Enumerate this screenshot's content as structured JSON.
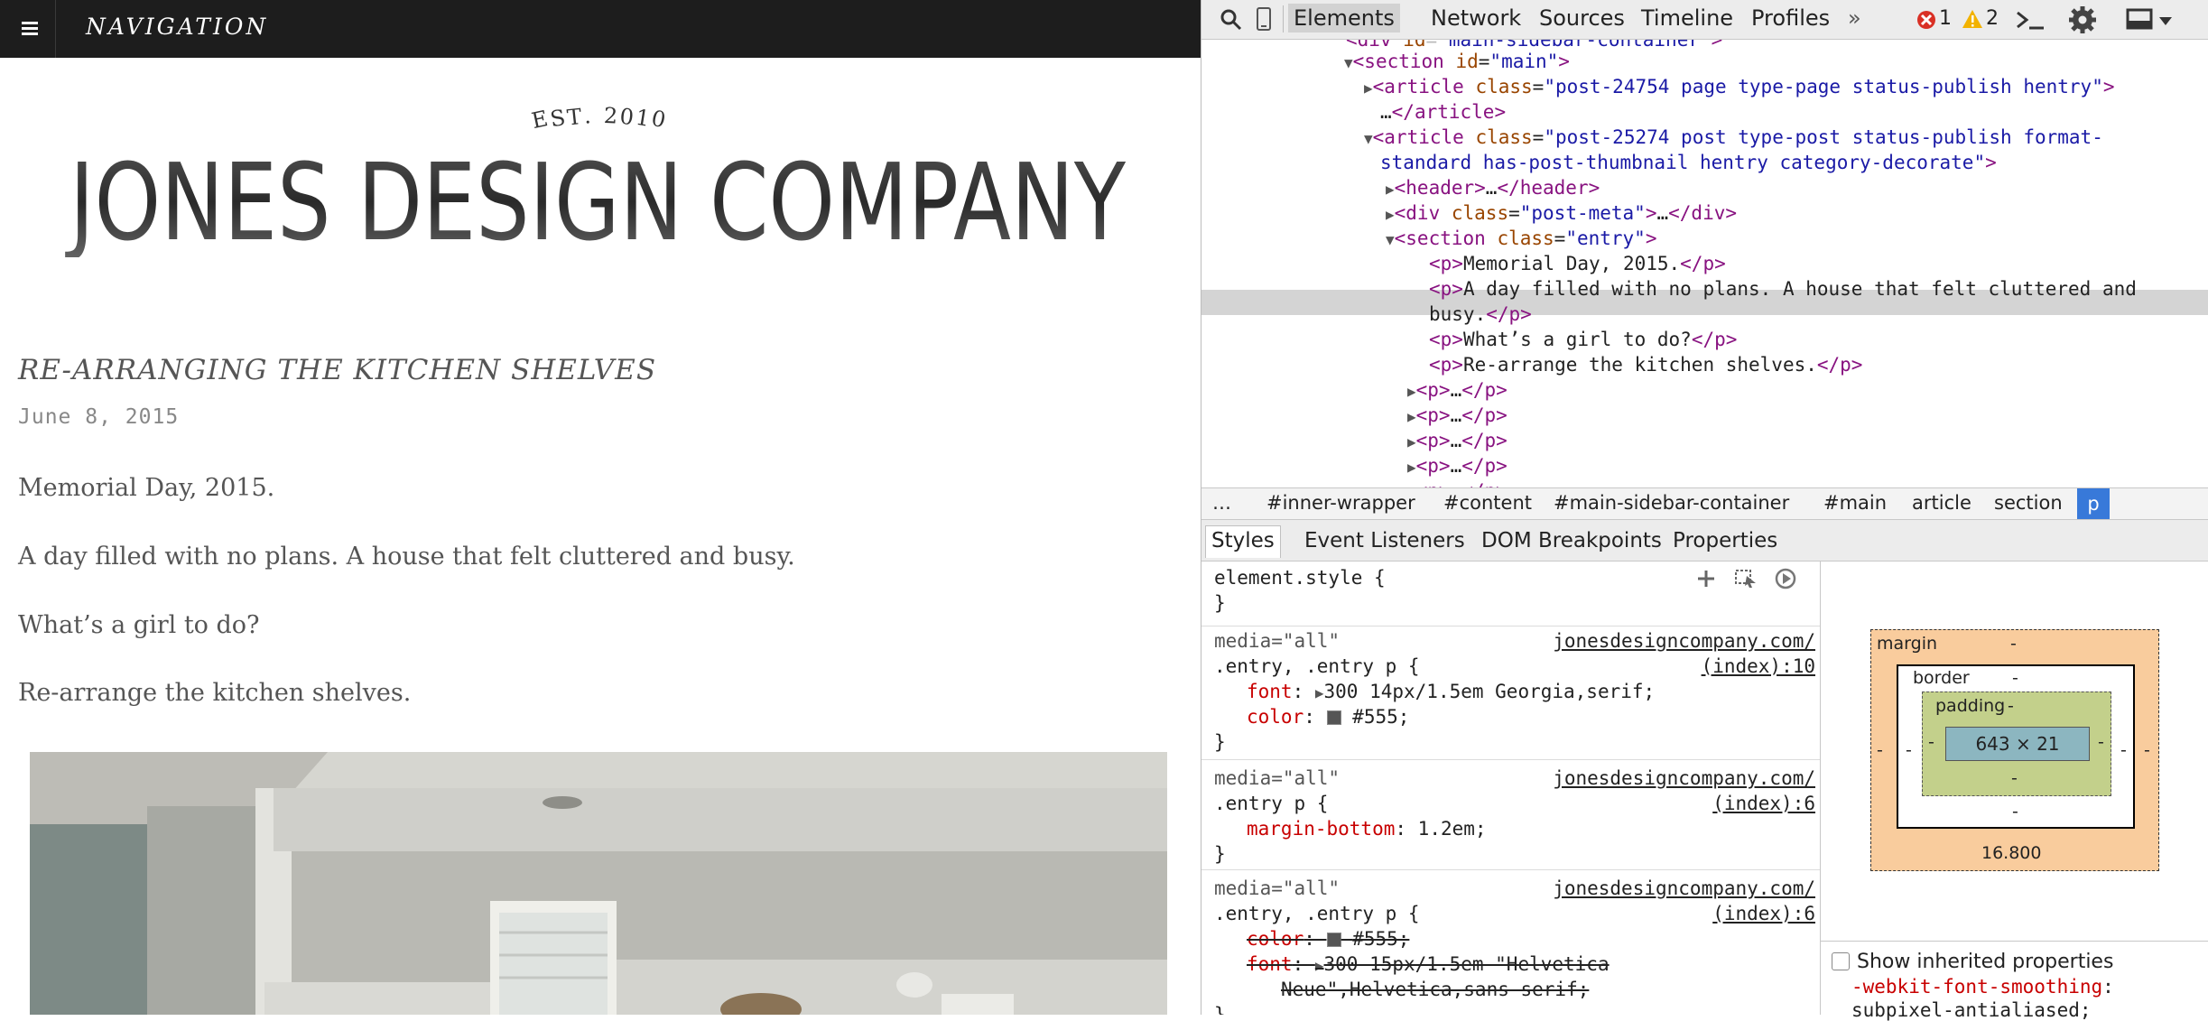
{
  "page": {
    "nav_label": "NAVIGATION",
    "logo_est": "EST. 2010",
    "logo_name": "JONES DESIGN COMPANY",
    "post_title": "RE-ARRANGING THE KITCHEN SHELVES",
    "post_date": "June 8, 2015",
    "paragraphs": [
      "Memorial Day, 2015.",
      "A day filled with no plans. A house that felt cluttered and busy.",
      "What’s a girl to do?",
      "Re-arrange the kitchen shelves."
    ]
  },
  "devtools": {
    "tabs": [
      "Elements",
      "Network",
      "Sources",
      "Timeline",
      "Profiles"
    ],
    "more": "»",
    "error_count": "1",
    "warning_count": "2",
    "icons": [
      "search-icon",
      "device-mode-icon",
      "console-drawer-icon",
      "gear-icon",
      "dock-icon"
    ],
    "dom": {
      "section_main": "section",
      "section_main_attr": "id",
      "section_main_val": "\"main\"",
      "article1_class": "\"post-24754 page type-page status-publish hentry\"",
      "article2_class_a": "\"post-25274 post type-post status-publish format-",
      "article2_class_b": "standard has-post-thumbnail hentry category-decorate\"",
      "postmeta_class": "\"post-meta\"",
      "entry_class": "\"entry\"",
      "p1": "Memorial Day, 2015.",
      "p2a": "A day filled with no plans. A house that felt cluttered and",
      "p2b": "busy.",
      "p3": "What’s a girl to do?",
      "p4": "Re-arrange the kitchen shelves."
    },
    "breadcrumbs": [
      "…",
      "#inner-wrapper",
      "#content",
      "#main-sidebar-container",
      "#main",
      "article",
      "section",
      "p"
    ],
    "sub_tabs": [
      "Styles",
      "Event Listeners",
      "DOM Breakpoints",
      "Properties"
    ],
    "styles": {
      "element_style": "element.style {",
      "media": "media=\"all\"",
      "source_host": "jonesdesigncompany.com/",
      "rule1_selector": ".entry, .entry p {",
      "rule1_source": "(index):10",
      "rule1_font": "300 14px/1.5em Georgia,serif;",
      "rule1_color": "#555;",
      "rule2_selector": ".entry p {",
      "rule2_source": "(index):6",
      "rule2_margin": "1.2em;",
      "rule3_selector": ".entry, .entry p {",
      "rule3_source": "(index):6",
      "rule3_color": "#555;",
      "rule3_font_a": "300 15px/1.5em \"Helvetica",
      "rule3_font_b": "Neue\",Helvetica,sans-serif;"
    },
    "metrics": {
      "margin_label": "margin",
      "border_label": "border",
      "padding_label": "padding",
      "dash": "-",
      "content_size": "643 × 21",
      "margin_bottom": "16.800"
    },
    "inherited_label": "Show inherited properties",
    "inherited_prop": "-webkit-font-smoothing",
    "inherited_val": "subpixel-antialiased;"
  }
}
